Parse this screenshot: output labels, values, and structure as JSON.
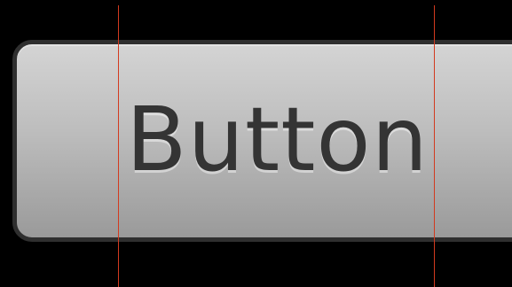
{
  "button": {
    "label": "Button"
  },
  "colors": {
    "background": "#000000",
    "button_border": "#2f2f2f",
    "button_gradient_top": "#d4d4d4",
    "button_gradient_bottom": "#9a9a9a",
    "label_text": "#343434",
    "guide_line": "#d23a1f"
  }
}
